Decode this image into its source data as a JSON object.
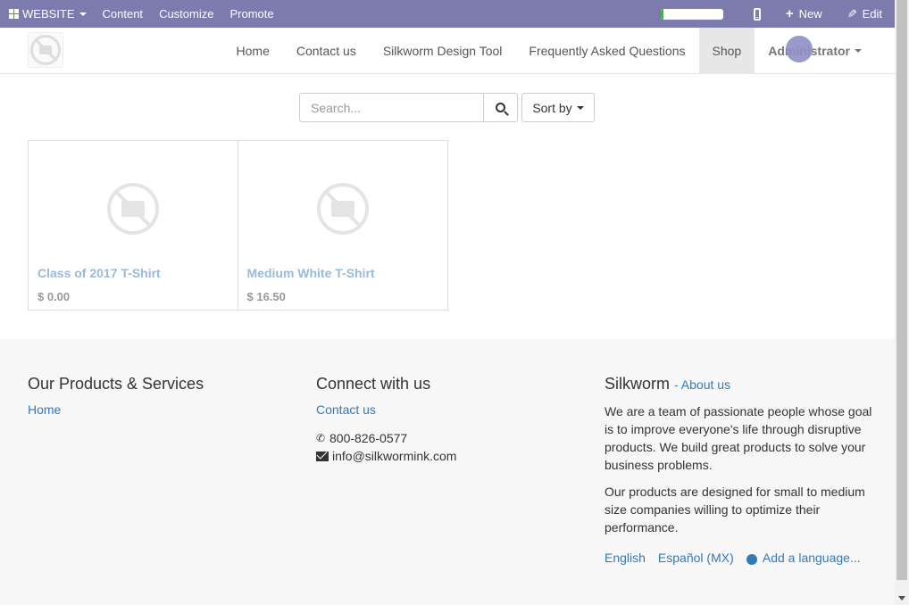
{
  "adminbar": {
    "website_label": "WEBSITE",
    "content_label": "Content",
    "customize_label": "Customize",
    "promote_label": "Promote",
    "progress_fraction": 0.05,
    "new_label": "New",
    "edit_label": "Edit",
    "bg_color": "#7c7bad"
  },
  "navbar": {
    "links": [
      "Home",
      "Contact us",
      "Silkworm Design Tool",
      "Frequently Asked Questions",
      "Shop",
      "Administrator"
    ],
    "active": "Shop"
  },
  "search": {
    "placeholder": "Search...",
    "sort_label": "Sort by"
  },
  "products": [
    {
      "name": "Class of 2017 T-Shirt",
      "price": "$ 0.00"
    },
    {
      "name": "Medium White T-Shirt",
      "price": "$ 16.50"
    }
  ],
  "footer": {
    "col1": {
      "title": "Our Products & Services",
      "link": "Home"
    },
    "col2": {
      "title": "Connect with us",
      "link": "Contact us",
      "phone": "800-826-0577",
      "email": "info@silkwormink.com"
    },
    "col3": {
      "title": "Silkworm",
      "about": "- About us",
      "p1": "We are a team of passionate people whose goal is to improve everyone's life through disruptive products. We build great products to solve your business problems.",
      "p2": "Our products are designed for small to medium size companies willing to optimize their performance.",
      "lang1": "English",
      "lang2": "Español (MX)",
      "add_lang": "Add a language..."
    }
  }
}
